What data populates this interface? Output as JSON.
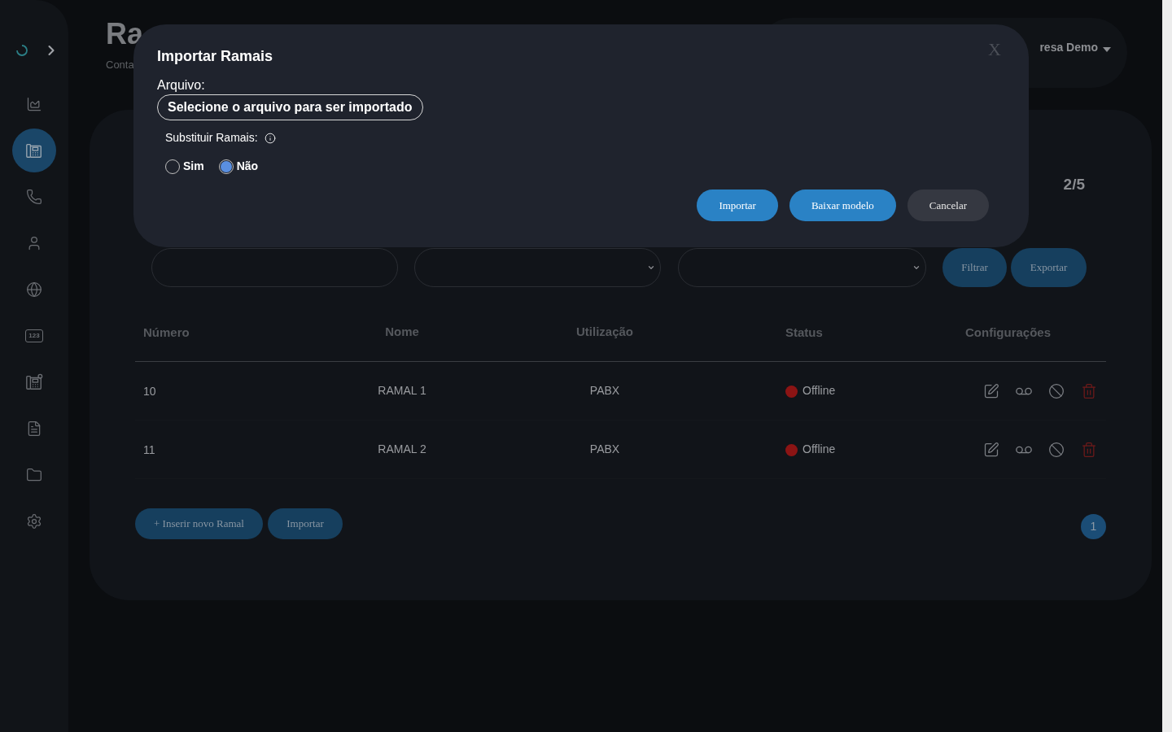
{
  "sidebar": {
    "items": [
      {
        "kind": "chart",
        "selected": false
      },
      {
        "kind": "deskphone",
        "selected": true
      },
      {
        "kind": "phone",
        "selected": false
      },
      {
        "kind": "user",
        "selected": false
      },
      {
        "kind": "globe",
        "selected": false
      },
      {
        "kind": "numbers",
        "label": "123",
        "selected": false
      },
      {
        "kind": "fax",
        "selected": false
      },
      {
        "kind": "document",
        "selected": false
      },
      {
        "kind": "folder",
        "selected": false
      },
      {
        "kind": "settings",
        "selected": false
      }
    ]
  },
  "header": {
    "title": "Ra",
    "breadcrumb": "Conta",
    "account": "resa Demo"
  },
  "card": {
    "counter": "2/5",
    "filter_buttons": [
      "Filtrar",
      "Exportar"
    ]
  },
  "table": {
    "columns": [
      "Número",
      "Nome",
      "Utilização",
      "Status",
      "Configurações"
    ],
    "rows": [
      {
        "numero": "10",
        "nome": "RAMAL 1",
        "utilizacao": "PABX",
        "status": "Offline",
        "color": "#8c1414"
      },
      {
        "numero": "11",
        "nome": "RAMAL 2",
        "utilizacao": "PABX",
        "status": "Offline",
        "color": "#8c1414"
      }
    ]
  },
  "footer_buttons": [
    "+ Inserir novo Ramal",
    "Importar"
  ],
  "pagination": [
    {
      "label": "1",
      "selected": true
    }
  ],
  "modal": {
    "title": "Importar Ramais",
    "close": "X",
    "file_label": "Arquivo:",
    "file_button": "Selecione o arquivo para ser importado",
    "replace_label": "Substituir Ramais:",
    "options": [
      {
        "label": "Sim",
        "selected": false
      },
      {
        "label": "Não",
        "selected": true
      }
    ],
    "buttons": [
      {
        "label": "Importar",
        "kind": "primary"
      },
      {
        "label": "Baixar modelo",
        "kind": "primary"
      },
      {
        "label": "Cancelar",
        "kind": "secondary"
      }
    ]
  }
}
